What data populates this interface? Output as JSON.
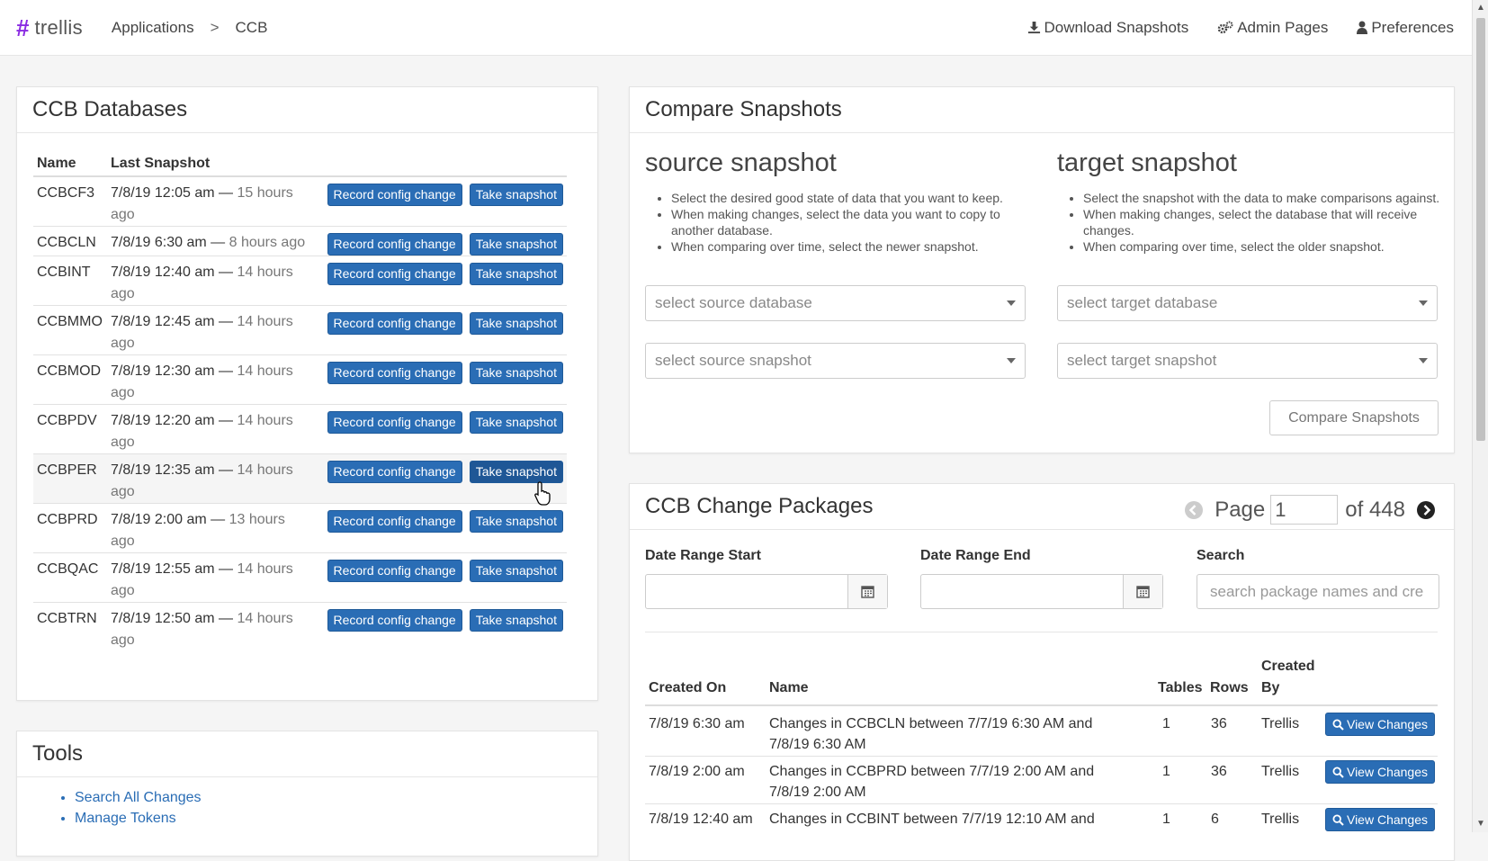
{
  "brand": {
    "name": "trellis",
    "accent": "#8a2be2"
  },
  "breadcrumb": {
    "items": [
      "Applications",
      "CCB"
    ],
    "separator": ">"
  },
  "nav": {
    "download": "Download Snapshots",
    "admin": "Admin Pages",
    "preferences": "Preferences"
  },
  "databases": {
    "title": "CCB Databases",
    "col_name": "Name",
    "col_snapshot": "Last Snapshot",
    "record_label": "Record config change",
    "snapshot_label": "Take snapshot",
    "rows": [
      {
        "name": "CCBCF3",
        "date": "7/8/19 12:05 am —",
        "ago": "15 hours",
        "ago2": "ago"
      },
      {
        "name": "CCBCLN",
        "date": "7/8/19 6:30 am —",
        "ago": "8 hours ago",
        "ago2": ""
      },
      {
        "name": "CCBINT",
        "date": "7/8/19 12:40 am —",
        "ago": "14 hours",
        "ago2": "ago"
      },
      {
        "name": "CCBMMO",
        "date": "7/8/19 12:45 am —",
        "ago": "14 hours",
        "ago2": "ago"
      },
      {
        "name": "CCBMOD",
        "date": "7/8/19 12:30 am —",
        "ago": "14 hours",
        "ago2": "ago"
      },
      {
        "name": "CCBPDV",
        "date": "7/8/19 12:20 am —",
        "ago": "14 hours",
        "ago2": "ago"
      },
      {
        "name": "CCBPER",
        "date": "7/8/19 12:35 am —",
        "ago": "14 hours",
        "ago2": "ago"
      },
      {
        "name": "CCBPRD",
        "date": "7/8/19 2:00 am —",
        "ago": "13 hours",
        "ago2": "ago"
      },
      {
        "name": "CCBQAC",
        "date": "7/8/19 12:55 am —",
        "ago": "14 hours",
        "ago2": "ago"
      },
      {
        "name": "CCBTRN",
        "date": "7/8/19 12:50 am —",
        "ago": "14 hours",
        "ago2": "ago"
      }
    ]
  },
  "compare": {
    "title": "Compare Snapshots",
    "source": {
      "heading": "source snapshot",
      "bullets": [
        "Select the desired good state of data that you want to keep.",
        "When making changes, select the data you want to copy to another database.",
        "When comparing over time, select the newer snapshot."
      ],
      "db_placeholder": "select source database",
      "snap_placeholder": "select source snapshot"
    },
    "target": {
      "heading": "target snapshot",
      "bullets": [
        "Select the snapshot with the data to make comparisons against.",
        "When making changes, select the database that will receive changes.",
        "When comparing over time, select the older snapshot."
      ],
      "db_placeholder": "select target database",
      "snap_placeholder": "select target snapshot"
    },
    "button": "Compare Snapshots"
  },
  "packages": {
    "title": "CCB Change Packages",
    "page_label": "Page",
    "page_value": "1",
    "page_of": "of 448",
    "date_start_label": "Date Range Start",
    "date_end_label": "Date Range End",
    "search_label": "Search",
    "search_placeholder": "search package names and cre",
    "headers": {
      "created_on": "Created On",
      "name": "Name",
      "tables": "Tables",
      "rows": "Rows",
      "created_by_1": "Created",
      "created_by_2": "By"
    },
    "view_label": "View Changes",
    "rows": [
      {
        "created": "7/8/19 6:30 am",
        "name1": "Changes in CCBCLN between 7/7/19 6:30 AM and",
        "name2": "7/8/19 6:30 AM",
        "tables": "1",
        "rows": "36",
        "by": "Trellis"
      },
      {
        "created": "7/8/19 2:00 am",
        "name1": "Changes in CCBPRD between 7/7/19 2:00 AM and",
        "name2": "7/8/19 2:00 AM",
        "tables": "1",
        "rows": "36",
        "by": "Trellis"
      },
      {
        "created": "7/8/19 12:40 am",
        "name1": "Changes in CCBINT between 7/7/19 12:10 AM and",
        "name2": "",
        "tables": "1",
        "rows": "6",
        "by": "Trellis"
      }
    ]
  },
  "tools": {
    "title": "Tools",
    "links": [
      "Search All Changes",
      "Manage Tokens"
    ]
  }
}
